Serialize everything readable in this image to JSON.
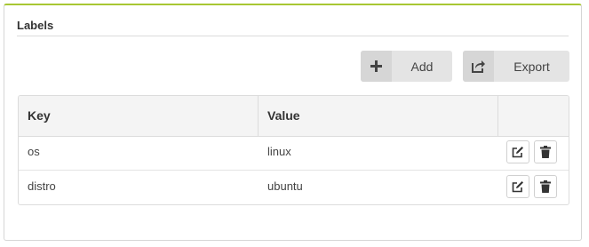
{
  "section": {
    "title": "Labels"
  },
  "toolbar": {
    "add": {
      "label": "Add",
      "icon": "plus-icon"
    },
    "export": {
      "label": "Export",
      "icon": "share-icon"
    }
  },
  "table": {
    "columns": [
      "Key",
      "Value",
      ""
    ],
    "rows": [
      {
        "key": "os",
        "value": "linux"
      },
      {
        "key": "distro",
        "value": "ubuntu"
      }
    ],
    "row_actions": [
      "edit-icon",
      "trash-icon"
    ]
  },
  "colors": {
    "accent": "#a8c733",
    "button_bg": "#e4e4e4",
    "header_bg": "#f4f4f4"
  }
}
